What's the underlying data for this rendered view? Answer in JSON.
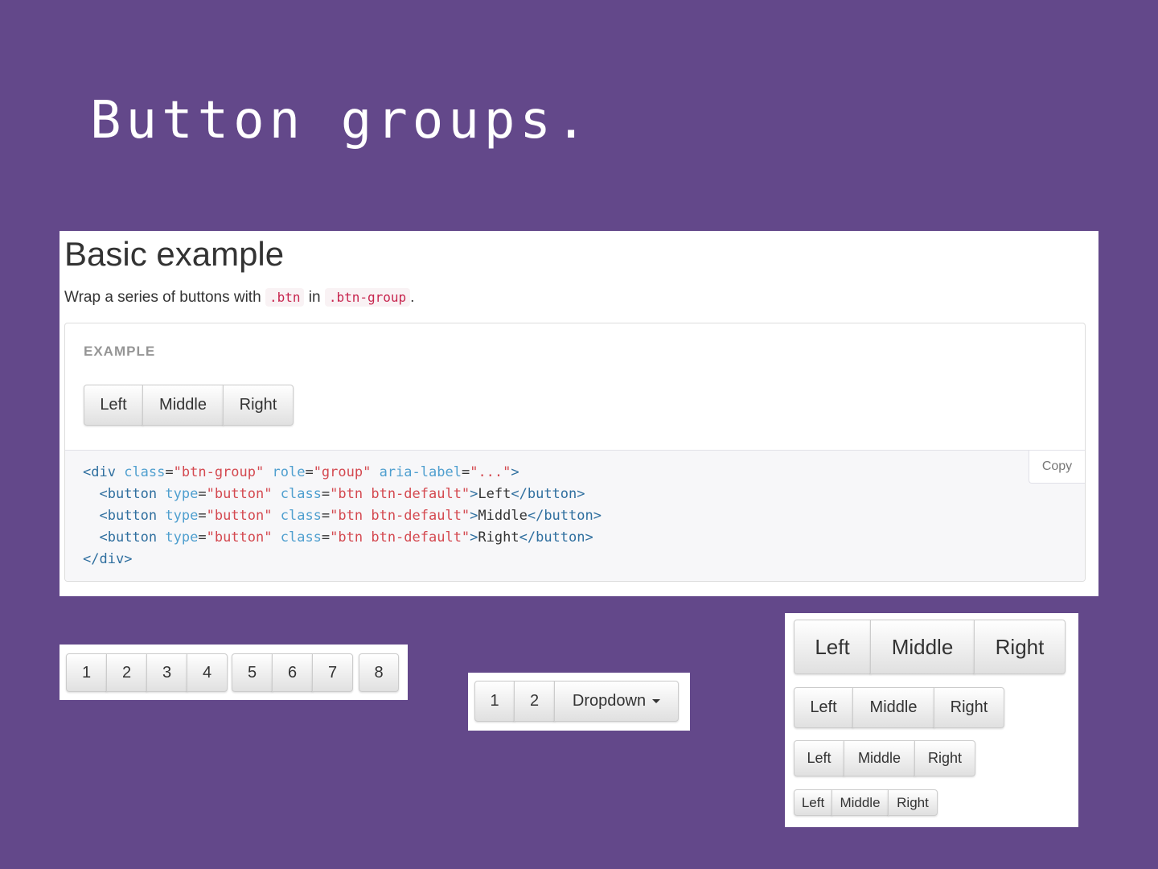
{
  "slide": {
    "title": "Button groups."
  },
  "basic": {
    "heading": "Basic example",
    "desc_before": "Wrap a series of buttons with ",
    "code1": ".btn",
    "desc_mid": " in ",
    "code2": ".btn-group",
    "desc_after": ".",
    "example_label": "EXAMPLE",
    "buttons": [
      "Left",
      "Middle",
      "Right"
    ],
    "copy_label": "Copy",
    "code_lines": [
      "<div class=\"btn-group\" role=\"group\" aria-label=\"...\">",
      "  <button type=\"button\" class=\"btn btn-default\">Left</button>",
      "  <button type=\"button\" class=\"btn btn-default\">Middle</button>",
      "  <button type=\"button\" class=\"btn btn-default\">Right</button>",
      "</div>"
    ]
  },
  "toolbar": {
    "group1": [
      "1",
      "2",
      "3",
      "4"
    ],
    "group2": [
      "5",
      "6",
      "7"
    ],
    "group3": [
      "8"
    ]
  },
  "nested": {
    "buttons": [
      "1",
      "2"
    ],
    "dropdown_label": "Dropdown",
    "dropdown_icon": "caret-down-icon"
  },
  "sizing": {
    "large": [
      "Left",
      "Middle",
      "Right"
    ],
    "default": [
      "Left",
      "Middle",
      "Right"
    ],
    "small": [
      "Left",
      "Middle",
      "Right"
    ],
    "xsmall": [
      "Left",
      "Middle",
      "Right"
    ]
  }
}
